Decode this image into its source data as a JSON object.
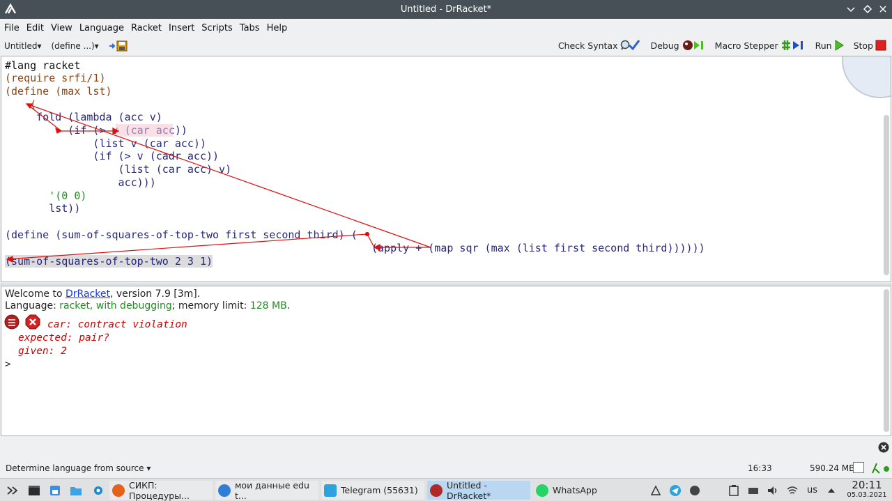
{
  "window": {
    "title": "Untitled - DrRacket*",
    "controls": [
      "chevron-down",
      "diamond",
      "close"
    ]
  },
  "menu": [
    "File",
    "Edit",
    "View",
    "Language",
    "Racket",
    "Insert",
    "Scripts",
    "Tabs",
    "Help"
  ],
  "toolbar": {
    "file_dropdown": "Untitled",
    "define_dropdown": "(define ...)",
    "check_syntax": "Check Syntax",
    "debug": "Debug",
    "macro_stepper": "Macro Stepper",
    "run": "Run",
    "stop": "Stop"
  },
  "editor": {
    "lines": [
      "#lang racket",
      "(require srfi/1)",
      "(define (max lst)",
      "    (",
      "     fold (lambda (acc v)",
      "          (if (> v (car acc))",
      "              (list v (car acc))",
      "              (if (> v (cadr acc))",
      "                  (list (car acc) v)",
      "                  acc)))",
      "       '(0 0)",
      "       lst))",
      "",
      "(define (sum-of-squares-of-top-two first second third) (",
      "(apply + (map sqr (max (list first second third))))))",
      "(sum-of-squares-of-top-two 2 3 1)"
    ]
  },
  "interactions": {
    "welcome_prefix": "Welcome to ",
    "welcome_link": "DrRacket",
    "welcome_suffix": ", version 7.9 [3m].",
    "language_prefix": "Language: ",
    "language_value": "racket, with debugging",
    "language_mid": "; memory limit: ",
    "memory_value": "128 MB",
    "language_end": ".",
    "error_line1": "car: contract violation",
    "error_line2": "expected: pair?",
    "error_line3": "given: 2",
    "prompt": ">"
  },
  "status": {
    "language_selector": "Determine language from source",
    "position": "16:33",
    "memory": "590.24 MB"
  },
  "taskbar": {
    "tasks": [
      {
        "label": "СИКП: Процедуры...",
        "color": "#e8611a"
      },
      {
        "label": "мои данные edu t...",
        "color": "#2f7fd8"
      },
      {
        "label": "Telegram (55631)",
        "color": "#2aa3df"
      },
      {
        "label": "Untitled - DrRacket*",
        "color": "#b02a2a"
      },
      {
        "label": "WhatsApp",
        "color": "#25d366"
      }
    ],
    "keyboard_layout": "us",
    "time": "20:11",
    "date": "05.03.2021"
  },
  "colors": {
    "paren": "#8b4513",
    "symbol": "#262680",
    "number": "#228b22",
    "error": "#d10000",
    "arrow": "#e01010"
  }
}
